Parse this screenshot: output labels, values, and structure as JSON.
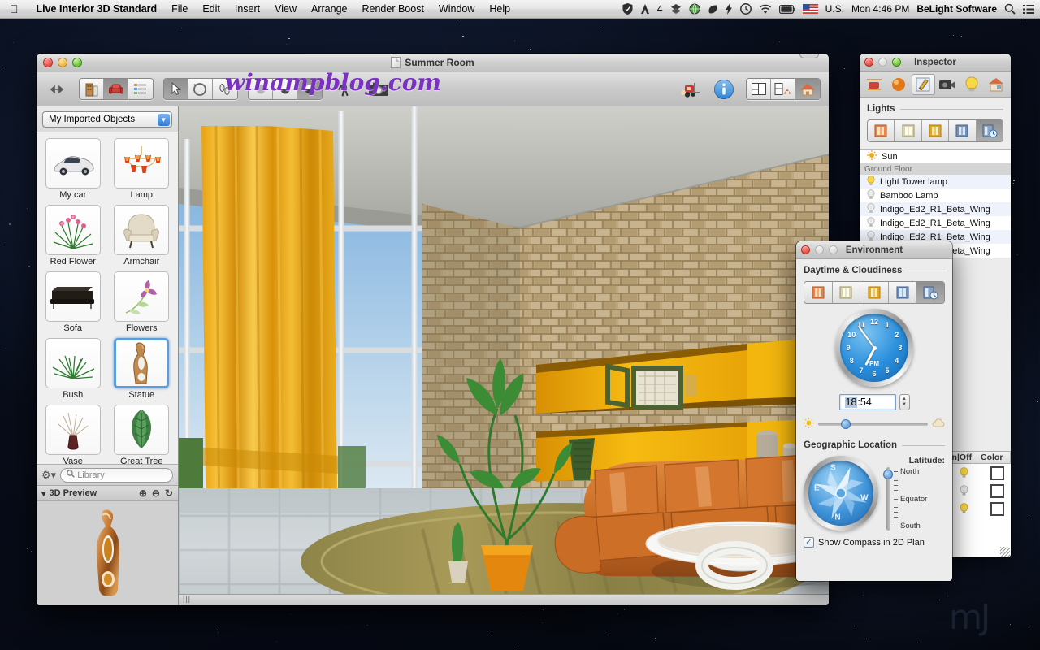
{
  "menubar": {
    "apple_icon": "apple-logo",
    "app_name": "Live Interior 3D Standard",
    "menus": [
      "File",
      "Edit",
      "Insert",
      "View",
      "Arrange",
      "Render Boost",
      "Window",
      "Help"
    ],
    "status_icons": [
      "shield-icon",
      "adobe-icon",
      "dropbox-icon",
      "globe-icon",
      "leaf-icon",
      "flash-icon",
      "timemachine-icon",
      "wifi-icon",
      "battery-icon"
    ],
    "adobe_badge": "4",
    "flag": "us-flag-icon",
    "input_source": "U.S.",
    "clock": "Mon 4:46 PM",
    "user": "BeLight Software",
    "spotlight_icon": "search-icon",
    "notification_icon": "list-icon"
  },
  "window": {
    "title": "Summer Room",
    "watermark": "winampblog.com",
    "toolbar": {
      "resize_icon": "arrows-horizontal-icon",
      "group1": [
        "building-icon",
        "armchair-icon",
        "list-icon"
      ],
      "group1_active": 1,
      "group2": [
        "arrow-select-icon",
        "orbit-icon",
        "walk-icon"
      ],
      "group2_active": 0,
      "group3": [
        "sphere-flat-icon",
        "sphere-shaded-icon",
        "sphere-render-icon"
      ],
      "group3_active": 2,
      "walker_icon": "walk-person-icon",
      "camera_icon": "camera-icon",
      "truck_icon": "forklift-icon",
      "info_icon": "info-icon",
      "views": [
        "plan-2d-icon",
        "split-view-icon",
        "view-3d-icon"
      ],
      "views_active": 2
    },
    "statusbar": "|||"
  },
  "sidebar": {
    "collection": "My Imported Objects",
    "items": [
      {
        "label": "My car",
        "icon": "car-icon",
        "selected": false
      },
      {
        "label": "Lamp",
        "icon": "chandelier-icon",
        "selected": false
      },
      {
        "label": "Red Flower",
        "icon": "red-flower-icon",
        "selected": false
      },
      {
        "label": "Armchair",
        "icon": "armchair-icon",
        "selected": false
      },
      {
        "label": "Sofa",
        "icon": "sofa-icon",
        "selected": false
      },
      {
        "label": "Flowers",
        "icon": "flowers-icon",
        "selected": false
      },
      {
        "label": "Bush",
        "icon": "bush-icon",
        "selected": false
      },
      {
        "label": "Statue",
        "icon": "statue-icon",
        "selected": true
      },
      {
        "label": "Vase",
        "icon": "vase-icon",
        "selected": false
      },
      {
        "label": "Great Tree",
        "icon": "tree-icon",
        "selected": false
      }
    ],
    "gear_icon": "gear-icon",
    "search_placeholder": "Library",
    "search_icon": "search-icon",
    "preview": {
      "disclosure_icon": "triangle-down-icon",
      "title": "3D Preview",
      "zoom_in_icon": "zoom-in-icon",
      "zoom_out_icon": "zoom-out-icon",
      "rotate_icon": "rotate-icon",
      "object": "bronze-statue"
    }
  },
  "inspector": {
    "title": "Inspector",
    "tabs": [
      "object-icon",
      "material-icon",
      "edit-icon",
      "camera-icon",
      "light-icon",
      "building-icon"
    ],
    "tabs_active": 2,
    "section_title": "Lights",
    "light_buttons": [
      "preset-warm-icon",
      "preset-neutral-icon",
      "preset-gold-icon",
      "preset-cool-icon",
      "preset-auto-icon"
    ],
    "light_buttons_active": 4,
    "list": [
      {
        "label": "Sun",
        "icon": "sun-icon",
        "group": false
      },
      {
        "label": "Ground Floor",
        "icon": "",
        "group": true
      },
      {
        "label": "Light Tower lamp",
        "icon": "bulb-on-icon",
        "group": false
      },
      {
        "label": "Bamboo Lamp",
        "icon": "bulb-off-icon",
        "group": false
      },
      {
        "label": "Indigo_Ed2_R1_Beta_Wing",
        "icon": "bulb-off-icon",
        "group": false
      },
      {
        "label": "Indigo_Ed2_R1_Beta_Wing",
        "icon": "bulb-off-icon",
        "group": false
      },
      {
        "label": "Indigo_Ed2_R1_Beta_Wing",
        "icon": "bulb-off-icon",
        "group": false
      },
      {
        "label": "Indigo_Ed2_R1_Beta_Wing",
        "icon": "bulb-off-icon",
        "group": false
      }
    ],
    "columns": [
      "On|Off",
      "Color"
    ],
    "bulbs": [
      "bulb-on-icon",
      "bulb-off-icon",
      "bulb-on-icon"
    ],
    "color_value": "#ffffff"
  },
  "environment": {
    "title": "Environment",
    "daytime_section": "Daytime & Cloudiness",
    "daytime_buttons": [
      "preset-sunrise-icon",
      "preset-day-icon",
      "preset-sunset-icon",
      "preset-night-icon",
      "preset-auto-icon"
    ],
    "daytime_active": 4,
    "clock": {
      "numbers": [
        "12",
        "1",
        "2",
        "3",
        "4",
        "5",
        "6",
        "7",
        "8",
        "9",
        "10",
        "11"
      ],
      "meridiem": "PM",
      "hour_angle": 207,
      "minute_angle": 324
    },
    "time_value": "18:54",
    "time_hour": "18",
    "time_sep": ":",
    "time_minute": "54",
    "stepper_icon": "stepper-icon",
    "cloudiness_value": 25,
    "sun_icon": "sun-small-icon",
    "cloud_icon": "cloud-icon",
    "geo_section": "Geographic Location",
    "compass_icon": "compass-rose",
    "compass_dirs": [
      "N",
      "E",
      "S",
      "W"
    ],
    "latitude_label": "Latitude:",
    "latitude_ticks": [
      "North",
      "",
      "",
      "",
      "Equator",
      "",
      "",
      "",
      "South"
    ],
    "latitude_value": 12,
    "checkbox_label": "Show Compass in 2D Plan",
    "checkbox_checked": true,
    "check_icon": "checkmark-icon"
  },
  "desktop": {
    "watermark": "mJ"
  },
  "colors": {
    "accent_blue": "#2f79d4",
    "curtain_gold": "#e8a317",
    "sofa_orange": "#d4712a",
    "stone_tan": "#bda478",
    "ceiling_grey": "#b9b9b4",
    "sky_blue": "#8cb8e0",
    "rug_olive": "#9d9455",
    "shelf_amber": "#f0a500"
  }
}
